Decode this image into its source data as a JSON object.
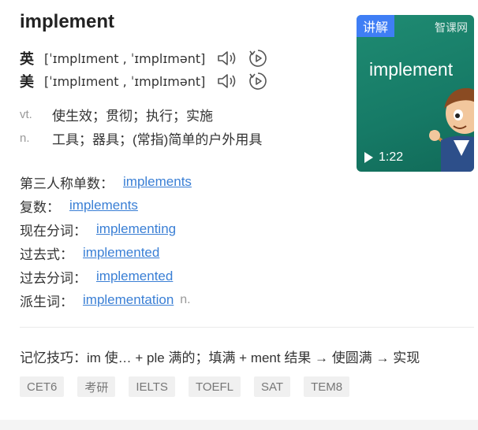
{
  "entry": {
    "word": "implement",
    "pronunciations": [
      {
        "lang": "英",
        "ipa": "[ˈɪmplɪment , ˈɪmplɪmənt]"
      },
      {
        "lang": "美",
        "ipa": "[ˈɪmplɪment , ˈɪmplɪmənt]"
      }
    ],
    "definitions": [
      {
        "pos": "vt.",
        "meaning": "使生效；贯彻；执行；实施"
      },
      {
        "pos": "n.",
        "meaning": "工具；器具；(常指)简单的户外用具"
      }
    ],
    "forms": [
      {
        "label": "第三人称单数：",
        "value": "implements",
        "suffix": ""
      },
      {
        "label": "复数：",
        "value": "implements",
        "suffix": ""
      },
      {
        "label": "现在分词：",
        "value": "implementing",
        "suffix": ""
      },
      {
        "label": "过去式：",
        "value": "implemented",
        "suffix": ""
      },
      {
        "label": "过去分词：",
        "value": "implemented",
        "suffix": ""
      },
      {
        "label": "派生词：",
        "value": "implementation",
        "suffix": "n."
      }
    ],
    "memory_tip": "记忆技巧：im 使… + ple 满的；填满 + ment 结果 → 使圆满 → 实现",
    "exam_tags": [
      "CET6",
      "考研",
      "IELTS",
      "TOEFL",
      "SAT",
      "TEM8"
    ]
  },
  "video": {
    "tag": "讲解",
    "brand": "智课网",
    "word": "implement",
    "duration": "1:22"
  },
  "colors": {
    "link": "#3a7fd5",
    "video_bg": "#1a8068",
    "tag_bg": "#3f7ef5"
  }
}
